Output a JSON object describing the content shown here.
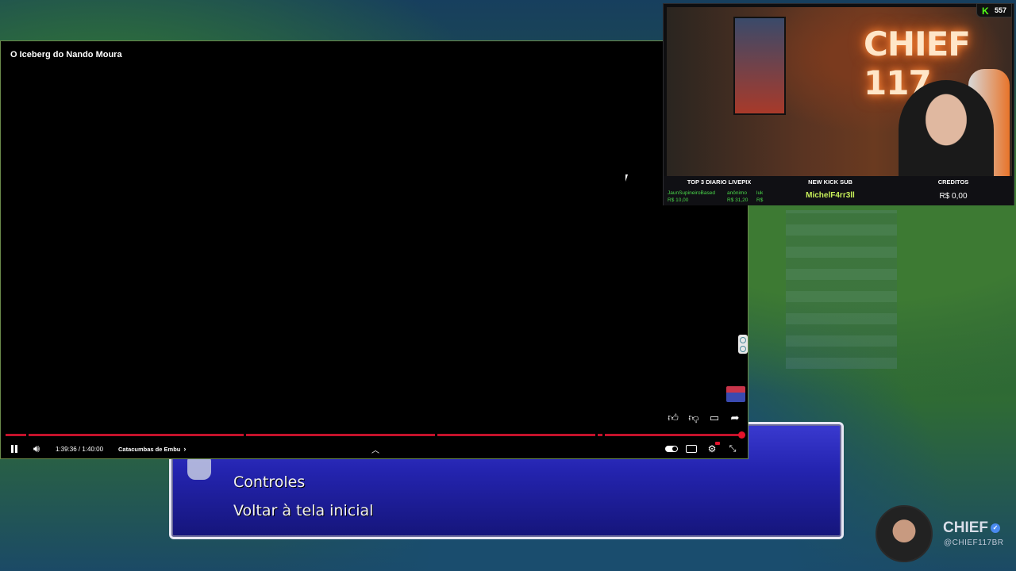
{
  "video": {
    "title": "O Iceberg do Nando Moura",
    "time": "1:39:36 / 1:40:00",
    "chapter": "Catacumbas de Embu",
    "chapter_arrow": "›",
    "progress_fraction": 0.996
  },
  "game_menu": {
    "items": [
      "Controles",
      "Voltar à tela inicial"
    ]
  },
  "stream": {
    "viewers": "557",
    "brand_logo_text": "CHIEF 117",
    "bar": {
      "livepix_header": "TOP 3 DIARIO LIVEPIX",
      "livepix": [
        {
          "name": "JaunSupineiroBased",
          "amount": "R$ 10,00"
        },
        {
          "name": "anônimo",
          "amount": "R$ 31,20"
        },
        {
          "name": "luk",
          "amount": "R$"
        }
      ],
      "sub_header": "NEW KICK SUB",
      "sub_name": "MichelF4rr3ll",
      "credits_header": "CREDITOS",
      "credits_value": "R$ 0,00"
    }
  },
  "branding": {
    "name": "CHIEF",
    "handle": "@CHIEF117BR"
  },
  "colors": {
    "progress_red": "#c4122b",
    "kick_green": "#53fc18",
    "menu_blue": "#2424b0"
  }
}
